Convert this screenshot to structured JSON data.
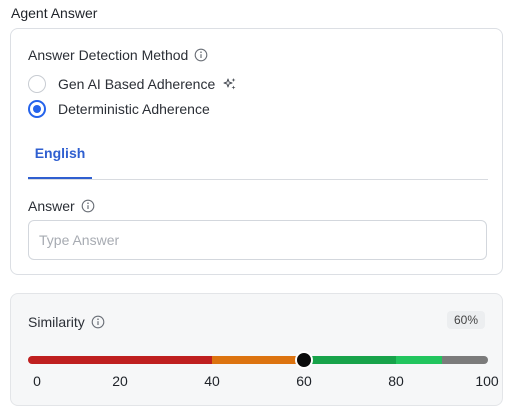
{
  "section_title": "Agent Answer",
  "detection": {
    "label": "Answer Detection Method",
    "options": [
      {
        "label": "Gen AI Based Adherence",
        "selected": false
      },
      {
        "label": "Deterministic Adherence",
        "selected": true
      }
    ]
  },
  "tabs": [
    {
      "label": "English",
      "active": true
    }
  ],
  "answer": {
    "label": "Answer",
    "placeholder": "Type Answer",
    "value": ""
  },
  "similarity": {
    "label": "Similarity",
    "value_text": "60%",
    "value": 60,
    "min": 0,
    "max": 100,
    "ticks": [
      "0",
      "20",
      "40",
      "60",
      "80",
      "100"
    ],
    "segments": [
      {
        "from": 0,
        "to": 40,
        "color": "#bf1f1f"
      },
      {
        "from": 40,
        "to": 60,
        "color": "#dc7310"
      },
      {
        "from": 60,
        "to": 80,
        "color": "#17a34a"
      },
      {
        "from": 80,
        "to": 90,
        "color": "#22c55e"
      },
      {
        "from": 90,
        "to": 100,
        "color": "#7b7b7b"
      }
    ]
  },
  "colors": {
    "accent": "#2563eb",
    "tab_active": "#2f5fd0"
  }
}
